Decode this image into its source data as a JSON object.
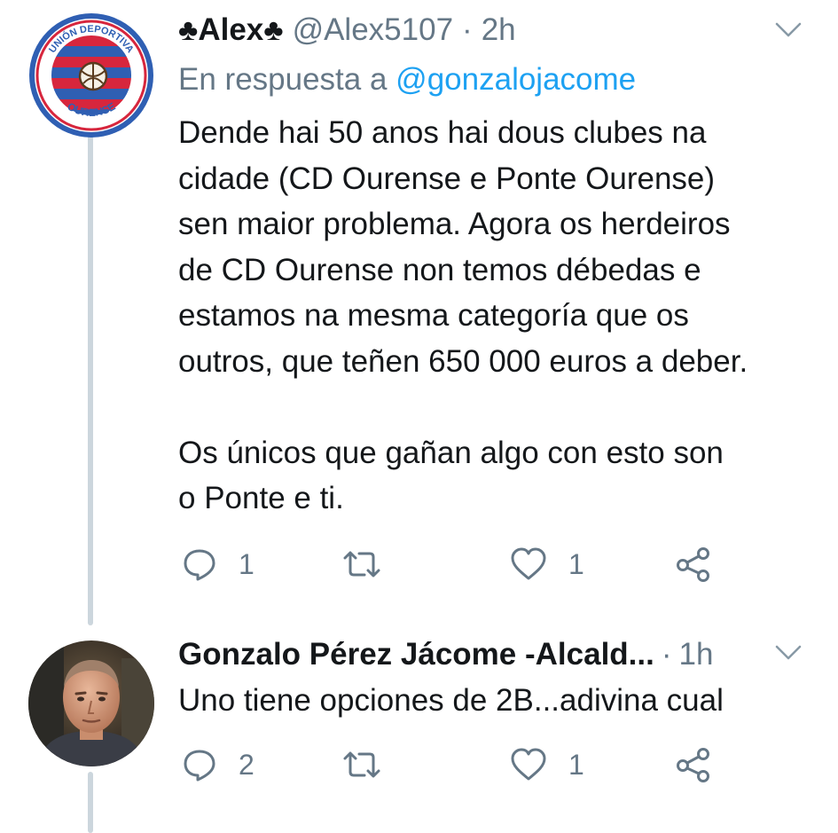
{
  "tweets": [
    {
      "avatar": "club-crest-avatar",
      "display_name": "Alex",
      "name_decoration": "♣",
      "handle": "@Alex5107",
      "separator": "·",
      "time": "2h",
      "reply_prefix": "En respuesta a",
      "reply_mention": "@gonzalojacome",
      "text": "Dende hai 50 anos hai dous clubes na\ncidade (CD Ourense e Ponte Ourense)\nsen maior problema. Agora os herdeiros\nde CD Ourense non temos débedas e\nestamos na mesma categoría que os\noutros, que teñen 650 000 euros a deber.\n\nOs únicos que gañan algo con esto son\no Ponte e ti.",
      "reply_count": "1",
      "like_count": "1",
      "crest": {
        "top_text": "UNIÓN DEPORTIVA",
        "bottom_text": "OURENSE"
      }
    },
    {
      "avatar": "person-photo-avatar",
      "display_name": "Gonzalo Pérez Jácome -Alcald...",
      "separator": "·",
      "time": "1h",
      "text": "Uno tiene opciones de 2B...adivina cual",
      "reply_count": "2",
      "like_count": "1"
    }
  ],
  "colors": {
    "text": "#14171a",
    "secondary": "#657786",
    "link": "#1da1f2",
    "thread_line": "#ccd6dd",
    "crest_red": "#d7263d",
    "crest_blue": "#2f5fb3"
  },
  "icons": [
    "reply-icon",
    "retweet-icon",
    "like-icon",
    "share-icon",
    "chevron-down-icon",
    "club-suit-icon"
  ]
}
